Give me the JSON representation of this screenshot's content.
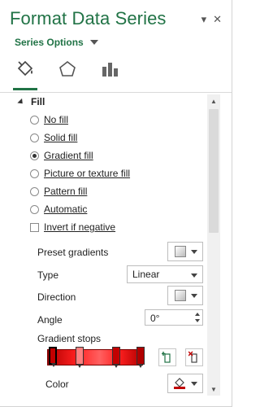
{
  "header": {
    "title": "Format Data Series",
    "pin_icon": "▾",
    "close_icon": "✕",
    "series_options_label": "Series Options"
  },
  "tabs": [
    {
      "name": "fill-line",
      "active": true
    },
    {
      "name": "effects",
      "active": false
    },
    {
      "name": "series-options",
      "active": false
    }
  ],
  "fill_section": {
    "label": "Fill",
    "options": [
      {
        "label": "No fill",
        "selected": false
      },
      {
        "label": "Solid fill",
        "selected": false
      },
      {
        "label": "Gradient fill",
        "selected": true
      },
      {
        "label": "Picture or texture fill",
        "selected": false
      },
      {
        "label": "Pattern fill",
        "selected": false
      },
      {
        "label": "Automatic",
        "selected": false
      }
    ],
    "invert_if_negative": {
      "label": "Invert if negative",
      "checked": false
    }
  },
  "gradient": {
    "preset_label": "Preset gradients",
    "type_label": "Type",
    "type_value": "Linear",
    "direction_label": "Direction",
    "angle_label": "Angle",
    "angle_value": "0°",
    "stops_label": "Gradient stops",
    "color_label": "Color"
  },
  "colors": {
    "accent": "#217346",
    "stop_color": "#c00000"
  }
}
